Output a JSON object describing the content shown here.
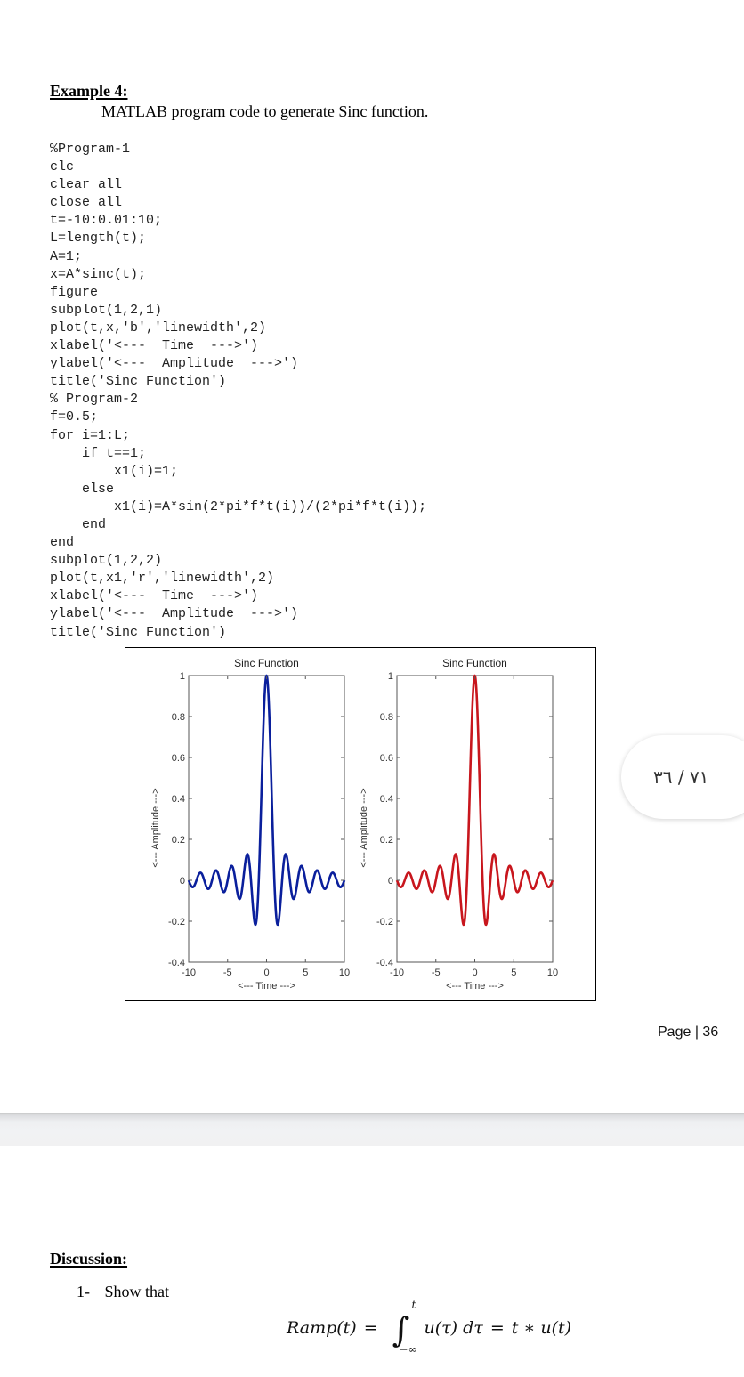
{
  "page1": {
    "example_title": "Example 4:",
    "example_description": "MATLAB program code to generate Sinc function.",
    "code_lines": [
      "%Program-1",
      "clc",
      "clear all",
      "close all",
      "t=-10:0.01:10;",
      "L=length(t);",
      "A=1;",
      "x=A*sinc(t);",
      "figure",
      "subplot(1,2,1)",
      "plot(t,x,'b','linewidth',2)",
      "xlabel('<---  Time  --->')",
      "ylabel('<---  Amplitude  --->')",
      "title('Sinc Function')",
      "% Program-2",
      "f=0.5;",
      "for i=1:L;",
      "    if t==1;",
      "        x1(i)=1;",
      "    else",
      "        x1(i)=A*sin(2*pi*f*t(i))/(2*pi*f*t(i));",
      "    end",
      "end",
      "subplot(1,2,2)",
      "plot(t,x1,'r','linewidth',2)",
      "xlabel('<---  Time  --->')",
      "ylabel('<---  Amplitude  --->')",
      "title('Sinc Function')"
    ],
    "page_number": "Page | 36"
  },
  "page_indicator": "٧١ / ٣٦",
  "page2": {
    "discussion_title": "Discussion:",
    "items": [
      {
        "number": "1-",
        "text": "Show that"
      }
    ],
    "equation": {
      "lhs": "Ramp(t)",
      "equals": "=",
      "integral_upper": "t",
      "integral_lower": "−∞",
      "integrand": "u(τ) dτ",
      "rhs": "t ∗ u(t)"
    }
  },
  "chart_data": [
    {
      "type": "line",
      "title": "Sinc Function",
      "xlabel": "<---  Time  --->",
      "ylabel": "<---  Amplitude  --->",
      "xlim": [
        -10,
        10
      ],
      "ylim": [
        -0.4,
        1
      ],
      "xticks": [
        "-10",
        "-5",
        "0",
        "5",
        "10"
      ],
      "yticks": [
        "-0.4",
        "-0.2",
        "0",
        "0.2",
        "0.4",
        "0.6",
        "0.8",
        "1"
      ],
      "grid": false,
      "series": [
        {
          "name": "x = A*sinc(t)",
          "color": "#0a1f9c",
          "function": "sinc",
          "amplitude": 1,
          "t_start": -10,
          "t_step": 0.01,
          "t_end": 10
        }
      ],
      "key_points": {
        "peak": [
          0,
          1
        ],
        "first_minima": [
          [
            -1.43,
            -0.217
          ],
          [
            1.43,
            -0.217
          ]
        ],
        "zeros": [
          -9,
          -8,
          -7,
          -6,
          -5,
          -4,
          -3,
          -2,
          -1,
          1,
          2,
          3,
          4,
          5,
          6,
          7,
          8,
          9
        ]
      }
    },
    {
      "type": "line",
      "title": "Sinc Function",
      "xlabel": "<---  Time  --->",
      "ylabel": "<---  Amplitude  --->",
      "xlim": [
        -10,
        10
      ],
      "ylim": [
        -0.4,
        1
      ],
      "xticks": [
        "-10",
        "-5",
        "0",
        "5",
        "10"
      ],
      "yticks": [
        "-0.4",
        "-0.2",
        "0",
        "0.2",
        "0.4",
        "0.6",
        "0.8",
        "1"
      ],
      "grid": false,
      "series": [
        {
          "name": "x1 = A*sin(2*pi*f*t)/(2*pi*f*t), f=0.5",
          "color": "#c8161d",
          "function": "sinc",
          "amplitude": 1,
          "t_start": -10,
          "t_step": 0.01,
          "t_end": 10
        }
      ],
      "key_points": {
        "peak": [
          0,
          1
        ],
        "first_minima": [
          [
            -1.43,
            -0.217
          ],
          [
            1.43,
            -0.217
          ]
        ],
        "zeros": [
          -9,
          -8,
          -7,
          -6,
          -5,
          -4,
          -3,
          -2,
          -1,
          1,
          2,
          3,
          4,
          5,
          6,
          7,
          8,
          9
        ]
      }
    }
  ]
}
